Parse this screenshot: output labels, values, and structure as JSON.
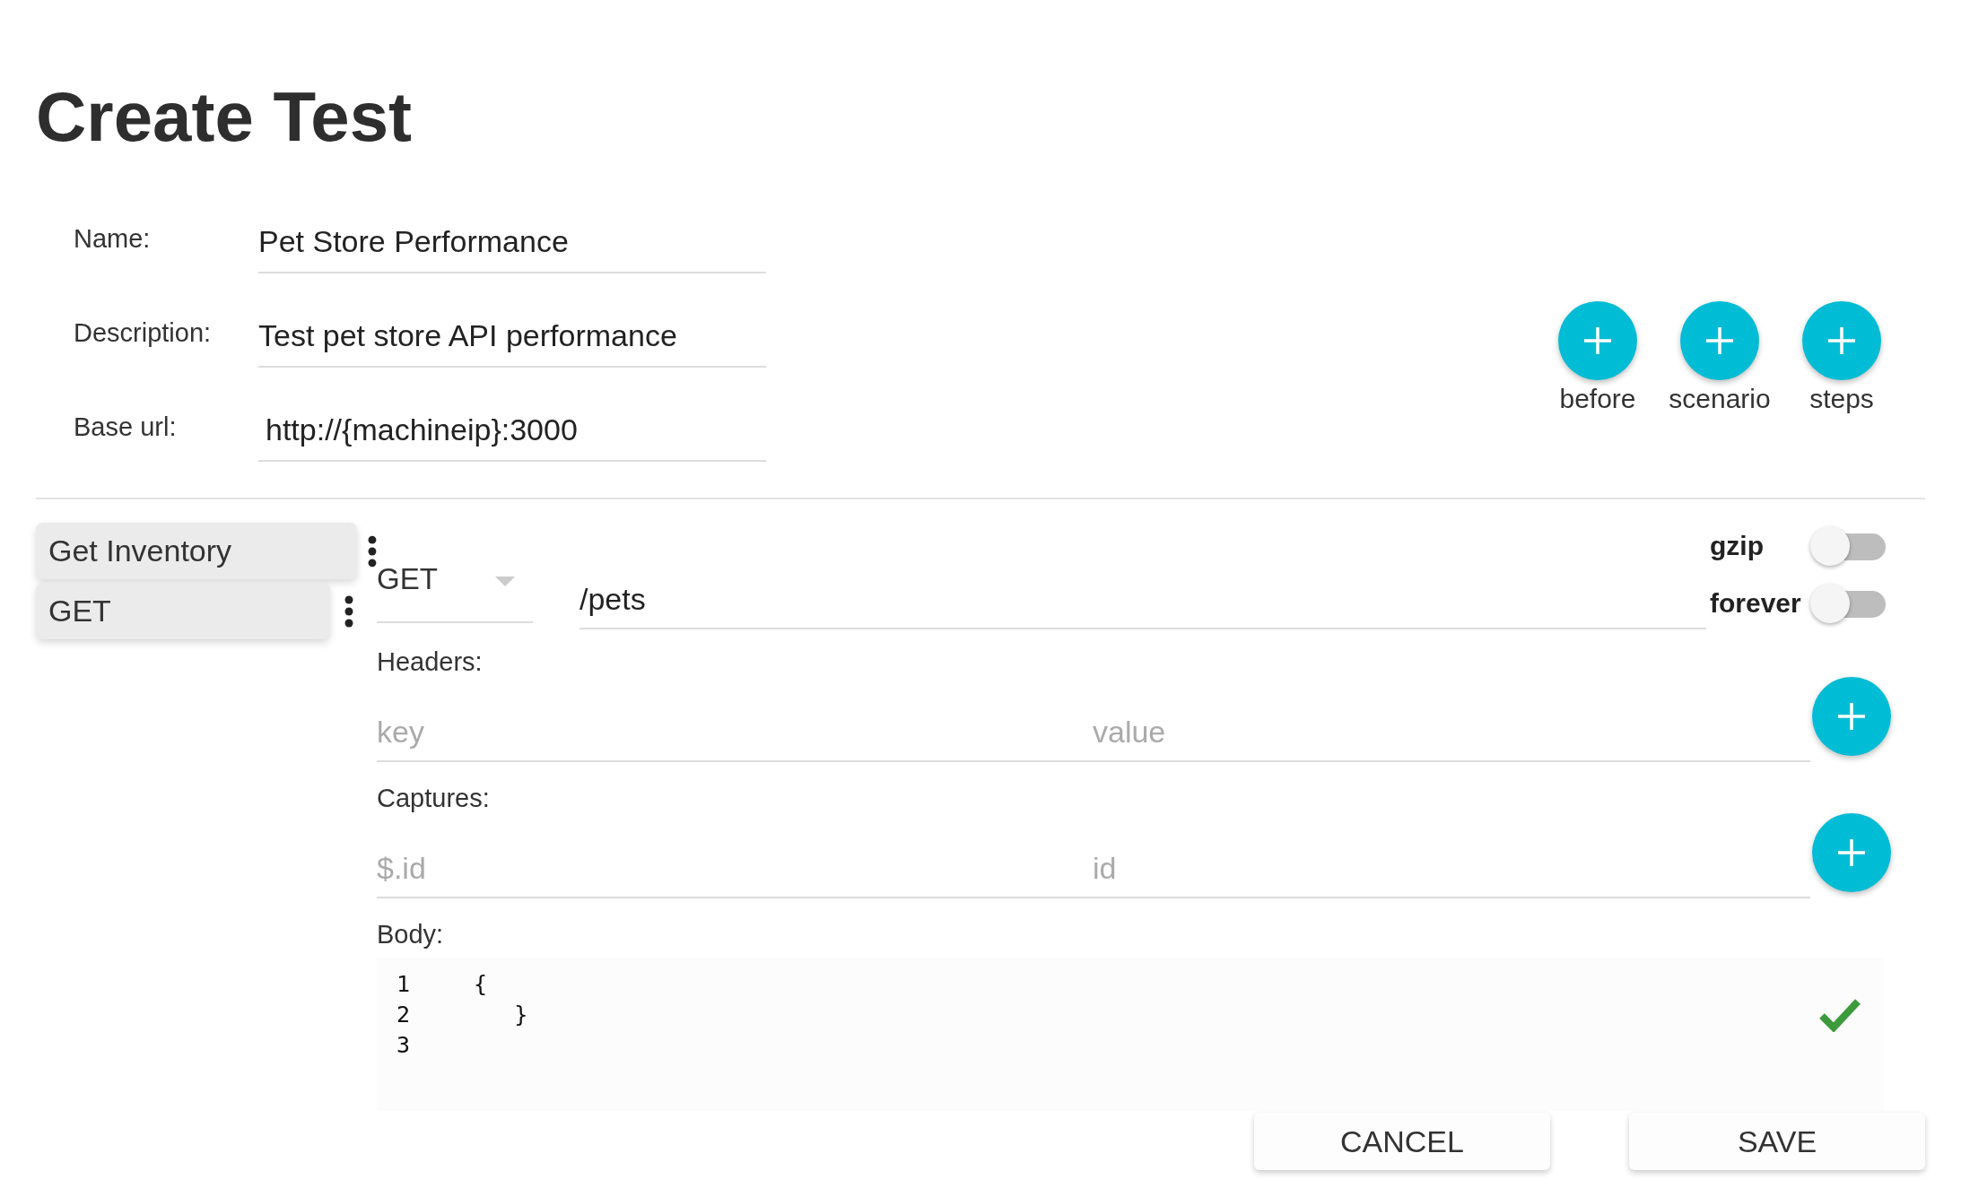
{
  "title": "Create Test",
  "form": [
    {
      "label": "Name:",
      "value": "Pet Store Performance"
    },
    {
      "label": "Description:",
      "value": "Test pet store API performance"
    },
    {
      "label": "Base url:",
      "value": "http://{machineip}:3000"
    }
  ],
  "add_buttons": [
    {
      "label": "before"
    },
    {
      "label": "scenario"
    },
    {
      "label": "steps"
    }
  ],
  "sidebar": {
    "items": [
      {
        "label": "Get Inventory"
      },
      {
        "label": "GET"
      }
    ]
  },
  "request": {
    "method": "GET",
    "path": "/pets",
    "toggles": [
      {
        "label": "gzip",
        "on": false
      },
      {
        "label": "forever",
        "on": false
      }
    ],
    "headers": {
      "label": "Headers:",
      "key_placeholder": "key",
      "value_placeholder": "value"
    },
    "captures": {
      "label": "Captures:",
      "key_placeholder": "$.id",
      "value_placeholder": "id"
    },
    "body": {
      "label": "Body:",
      "lines": [
        {
          "number": "1",
          "text": "{"
        },
        {
          "number": "2",
          "text": "   }"
        },
        {
          "number": "3"
        }
      ],
      "valid": true
    }
  },
  "buttons": [
    {
      "label": "CANCEL"
    },
    {
      "label": "SAVE"
    }
  ]
}
